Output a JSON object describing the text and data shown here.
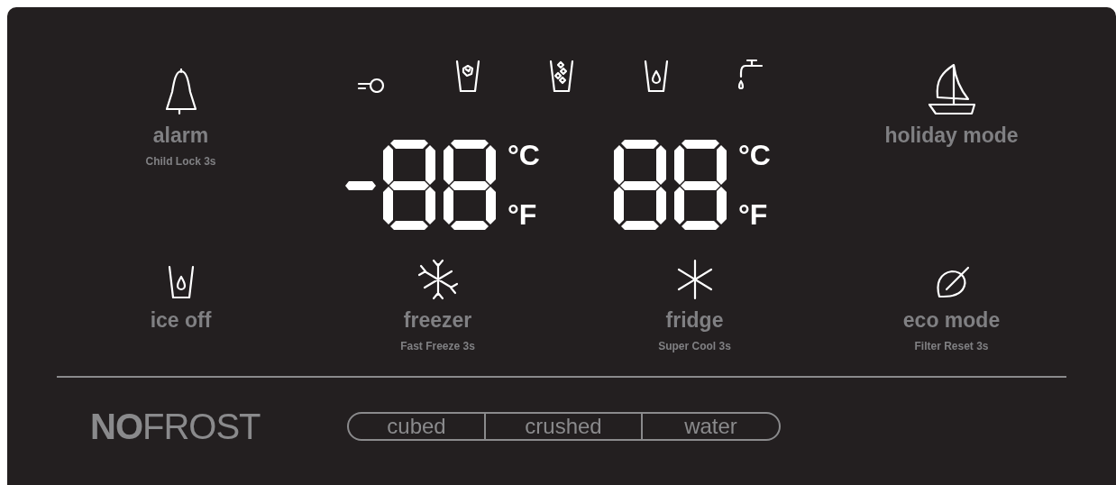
{
  "buttons_top": [
    {
      "kind": "bell",
      "label": "alarm",
      "sublabel": "Child Lock 3s"
    },
    {
      "kind": "boat",
      "label": "holiday mode"
    }
  ],
  "displays": [
    {
      "minus_segment": true,
      "units": [
        "°C",
        "°F"
      ]
    },
    {
      "minus_segment": false,
      "units": [
        "°C",
        "°F"
      ]
    }
  ],
  "buttons_bottom": [
    {
      "kind": "cup-drop",
      "label": "ice off"
    },
    {
      "kind": "snowflake",
      "label": "freezer",
      "sublabel": "Fast Freeze 3s"
    },
    {
      "kind": "asterisk",
      "label": "fridge",
      "sublabel": "Super Cool 3s"
    },
    {
      "kind": "leaf",
      "label": "eco mode",
      "sublabel": "Filter Reset 3s"
    }
  ],
  "brand": "**NO**FROST",
  "dispenser": [
    {
      "label": "cubed"
    },
    {
      "label": "crushed"
    },
    {
      "label": "water"
    }
  ]
}
